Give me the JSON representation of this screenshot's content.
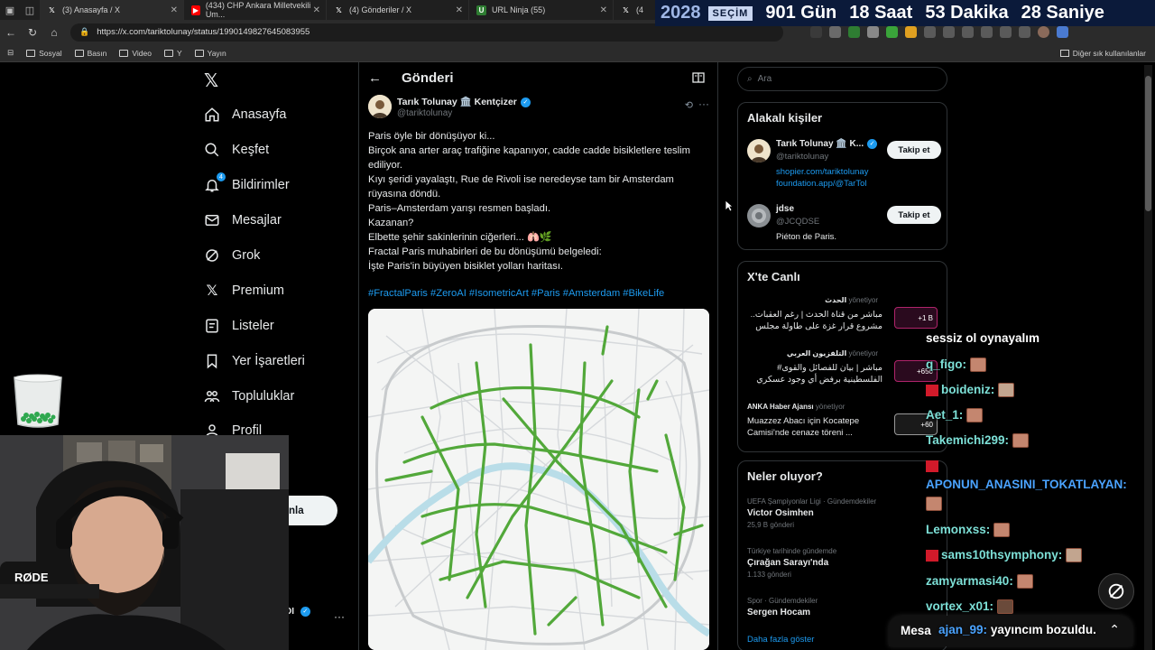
{
  "browser": {
    "tabs": [
      {
        "title": "(3) Anasayfa / X",
        "icon": "x-logo"
      },
      {
        "title": "(434) CHP Ankara Milletvekili Um...",
        "icon": "youtube-logo"
      },
      {
        "title": "(4) Gönderiler / X",
        "icon": "x-logo"
      },
      {
        "title": "URL Ninja (55)",
        "icon": "url-ninja-logo"
      },
      {
        "title": "(4",
        "icon": "x-logo"
      }
    ],
    "url": "https://x.com/tariktolunay/status/1990149827645083955",
    "bookmarks": [
      "Sosyal",
      "Basın",
      "Video",
      "Y",
      "Yayın"
    ],
    "other_bookmarks": "Diğer sık kullanılanlar"
  },
  "countdown": {
    "year": "2028",
    "tag": "SEÇİM",
    "days": "901 Gün",
    "hours": "18 Saat",
    "minutes": "53 Dakika",
    "seconds": "28 Saniye"
  },
  "sidebar": {
    "items": [
      {
        "label": "Anasayfa",
        "icon": "home-icon"
      },
      {
        "label": "Keşfet",
        "icon": "search-icon"
      },
      {
        "label": "Bildirimler",
        "icon": "bell-icon",
        "badge": "4"
      },
      {
        "label": "Mesajlar",
        "icon": "mail-icon"
      },
      {
        "label": "Grok",
        "icon": "grok-icon"
      },
      {
        "label": "Premium",
        "icon": "x-premium-icon"
      },
      {
        "label": "Listeler",
        "icon": "list-icon"
      },
      {
        "label": "Yer İşaretleri",
        "icon": "bookmark-icon"
      },
      {
        "label": "Topluluklar",
        "icon": "community-icon"
      },
      {
        "label": "Profil",
        "icon": "profile-icon"
      }
    ],
    "post_button": "nla"
  },
  "main": {
    "header_title": "Gönderi",
    "author_name": "Tarık Tolunay 🏛️ Kentçizer",
    "author_handle": "@tariktolunay",
    "lines": [
      "Paris öyle bir dönüşüyor ki...",
      "Birçok ana arter araç trafiğine kapanıyor, cadde cadde bisikletlere teslim ediliyor.",
      "Kıyı şeridi yayalaştı, Rue de Rivoli ise neredeyse tam bir Amsterdam rüyasına döndü.",
      "Paris–Amsterdam yarışı resmen başladı.",
      "Kazanan?",
      "Elbette şehir sakinlerinin ciğerleri... 🫁🌿",
      "Fractal Paris muhabirleri de bu dönüşümü belgeledi:",
      "İşte Paris'in büyüyen bisiklet yolları haritası."
    ],
    "hashtags": "#FractalParis #ZeroAI #IsometricArt #Paris #Amsterdam #BikeLife",
    "map_colors": {
      "bike_lane": "#52a83a",
      "river": "#b9dde8",
      "street": "#d6d9dc",
      "background": "#f4f5f4"
    }
  },
  "right": {
    "search_placeholder": "Ara",
    "related_title": "Alakalı kişiler",
    "people": [
      {
        "name": "Tarık Tolunay 🏛️ K...",
        "handle": "@tariktolunay",
        "bio1": "shopier.com/tariktolunay",
        "bio2": "foundation.app/@TarTol",
        "follow": "Takip et"
      },
      {
        "name": "jdse",
        "handle": "@JCQDSE",
        "bio1": "Piéton de Paris.",
        "follow": "Takip et"
      }
    ],
    "live_title": "X'te Canlı",
    "live": [
      {
        "source": "الحدث",
        "time": "yönetiyor",
        "text": "مباشر من قناة الحدث | رغم العقبات.. مشروع قرار غزة على طاولة مجلس",
        "count": "+1 B"
      },
      {
        "source": "التلفزيون العربي",
        "time": "yönetiyor",
        "text": "مباشر | بيان للفصائل والقوى# الفلسطينية برفض أي وجود عسكري",
        "count": "+650"
      },
      {
        "source": "ANKA Haber Ajansı",
        "time": "yönetiyor",
        "text": "Muazzez Abacı için Kocatepe Camisi'nde cenaze töreni ...",
        "count": "+60"
      }
    ],
    "trends_title": "Neler oluyor?",
    "trends": [
      {
        "category": "UEFA Şampiyonlar Ligi · Gündemdekiler",
        "name": "Victor Osimhen",
        "count": "25,9 B gönderi"
      },
      {
        "category": "Türkiye tarihinde gündemde",
        "name": "Çırağan Sarayı'nda",
        "count": "1.133 gönderi"
      },
      {
        "category": "Spor · Gündemdekiler",
        "name": "Sergen Hocam",
        "count": ""
      }
    ],
    "show_more": "Daha fazla göster"
  },
  "chat": {
    "title": "sessiz ol oynayalım",
    "messages": [
      {
        "user": "q_figo:",
        "text": ""
      },
      {
        "user": "boideniz:",
        "text": ""
      },
      {
        "user": "Aet_1:",
        "text": ""
      },
      {
        "user": "Takemichi299:",
        "text": ""
      },
      {
        "user": "APONUN_ANASINI_TOKATLAYAN:",
        "text": ""
      },
      {
        "user": "Lemonxss:",
        "text": ""
      },
      {
        "user": "sams10thsymphony:",
        "text": ""
      },
      {
        "user": "zamyarmasi40:",
        "text": ""
      },
      {
        "user": "vortex_x01:",
        "text": ""
      }
    ],
    "last_user": "ajan_99:",
    "last_text": "yayıncım bozuldu.",
    "messages_bar": "Mesa"
  },
  "webcam": {
    "mic_label": "RØDE"
  }
}
